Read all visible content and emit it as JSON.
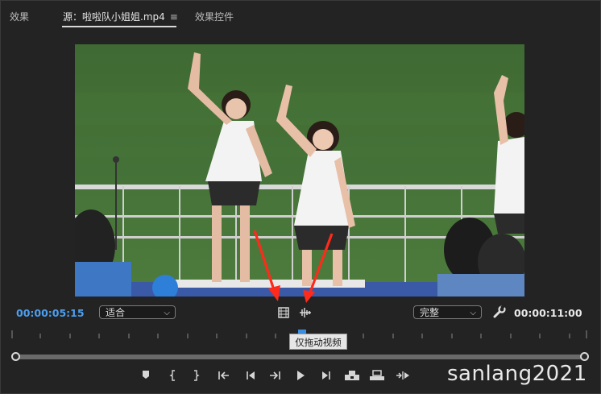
{
  "tabs": [
    {
      "label": "效果"
    },
    {
      "label": "源：啦啦队小姐姐.mp4"
    },
    {
      "label": "效果控件"
    }
  ],
  "tab_menu_icon": "≡",
  "timecode_current": "00:00:05:15",
  "timecode_duration": "00:00:11:00",
  "zoom_select": {
    "value": "适合"
  },
  "quality_select": {
    "value": "完整"
  },
  "tooltip": "仅拖动视频",
  "watermark": "sanlang2021",
  "colors": {
    "accent": "#3b8de0",
    "annotation": "#ff2a1a"
  },
  "icons": [
    "drag-video-only-icon",
    "drag-audio-only-icon",
    "wrench-icon",
    "add-marker-icon",
    "mark-in-icon",
    "mark-out-icon",
    "go-to-in-icon",
    "step-back-icon",
    "play-icon",
    "step-forward-icon",
    "go-to-out-icon",
    "insert-icon",
    "overwrite-icon",
    "export-frame-icon"
  ]
}
